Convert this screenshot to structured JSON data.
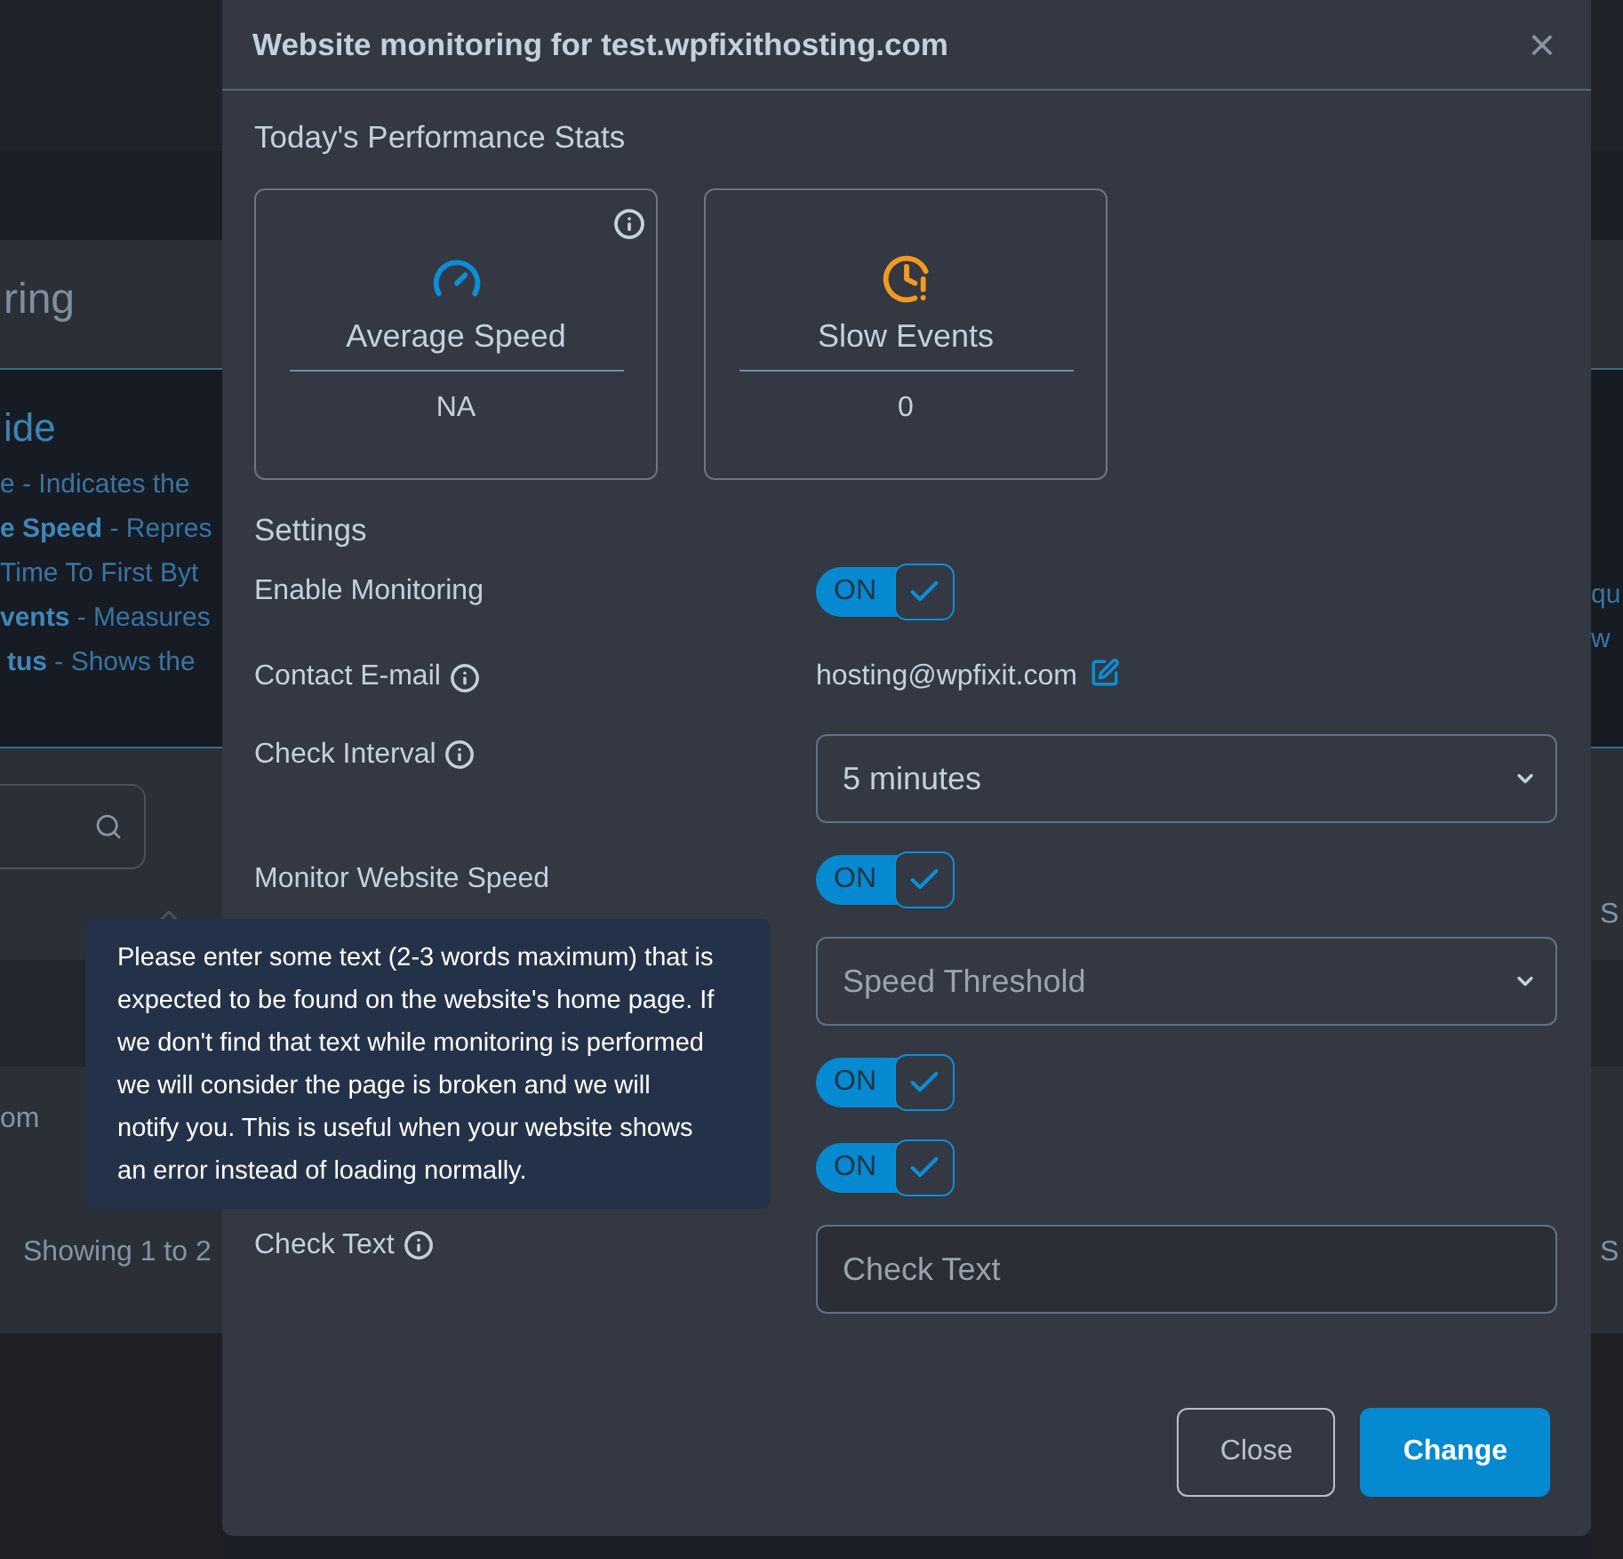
{
  "background": {
    "left": {
      "header": "ring",
      "guide_title": "ide",
      "guide_lines": [
        "e - Indicates the",
        "**e Speed** - Repres",
        "Time To First Byt",
        "**vents** - Measures",
        "**tus** - Shows the"
      ],
      "row_text": "om",
      "footer": "Showing 1 to 2"
    },
    "right": {
      "guide_lines": [
        "qu",
        "w"
      ],
      "cells": [
        "S",
        "S"
      ]
    }
  },
  "modal": {
    "title": "Website monitoring for test.wpfixithosting.com",
    "close": "×",
    "stats_title": "Today's Performance Stats",
    "stats": [
      {
        "kind": "speed",
        "label": "Average Speed",
        "value": "NA",
        "info": true,
        "color": "#0b8fd6"
      },
      {
        "kind": "slow",
        "label": "Slow Events",
        "value": "0",
        "info": false,
        "color": "#f29b1d"
      }
    ],
    "settings_title": "Settings",
    "rows": [
      {
        "kind": "toggle",
        "label": "Enable Monitoring",
        "info": false,
        "on": true,
        "state_label": "ON"
      },
      {
        "kind": "email",
        "label": "Contact E-mail",
        "info": true,
        "value": "hosting@wpfixit.com"
      },
      {
        "kind": "select",
        "label": "Check Interval",
        "info": true,
        "value": "5 minutes",
        "placeholder": false
      },
      {
        "kind": "toggle",
        "label": "Monitor Website Speed",
        "info": false,
        "on": true,
        "state_label": "ON"
      },
      {
        "kind": "select",
        "value": "Speed Threshold",
        "placeholder": true
      },
      {
        "kind": "toggle",
        "on": true,
        "state_label": "ON"
      },
      {
        "kind": "toggle",
        "on": true,
        "state_label": "ON"
      },
      {
        "kind": "input",
        "label": "Check Text",
        "info": true,
        "placeholder": "Check Text"
      }
    ],
    "buttons": [
      {
        "label": "Close",
        "primary": false
      },
      {
        "label": "Change",
        "primary": true
      }
    ]
  },
  "tooltip": {
    "text": "Please enter some text (2-3 words maximum) that is expected to be found on the website's home page. If we don't find that text while monitoring is performed we will consider the page is broken and we will notify you. This is useful when your website shows an error instead of loading normally."
  }
}
